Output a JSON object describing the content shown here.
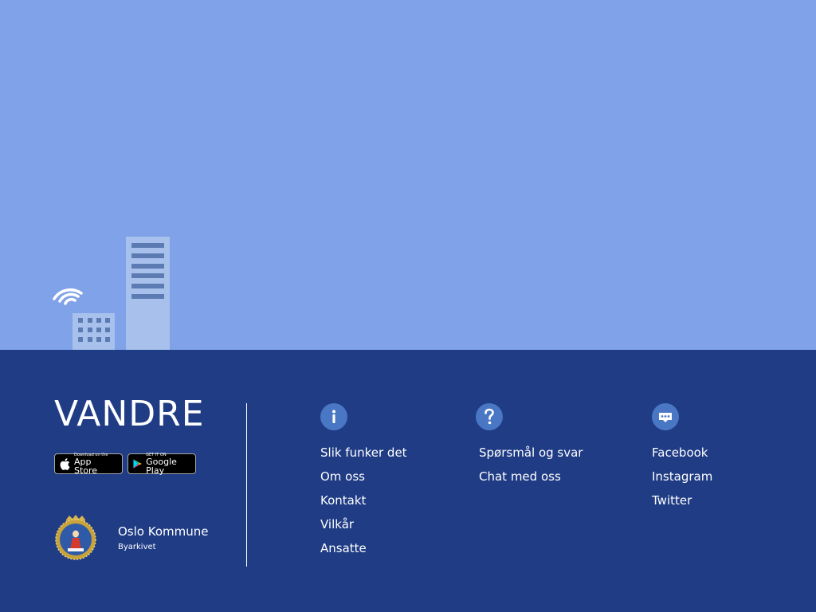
{
  "brand": {
    "name": "VANDRE"
  },
  "stores": {
    "apple": {
      "small": "Download on the",
      "big": "App Store",
      "icon": "apple-icon"
    },
    "google": {
      "small": "GET IT ON",
      "big": "Google Play",
      "icon": "google-play-icon"
    }
  },
  "city": {
    "name": "Oslo Kommune",
    "sub": "Byarkivet",
    "icon": "oslo-coat-of-arms-icon"
  },
  "columns": [
    {
      "icon": "info-icon",
      "links": [
        "Slik funker det",
        "Om oss",
        "Kontakt",
        "Vilkår",
        "Ansatte"
      ]
    },
    {
      "icon": "question-icon",
      "links": [
        "Spørsmål og svar",
        "Chat med oss"
      ]
    },
    {
      "icon": "chat-bubble-icon",
      "links": [
        "Facebook",
        "Instagram",
        "Twitter"
      ]
    }
  ],
  "colors": {
    "sky": "#80a2e8",
    "footer": "#1f3c85",
    "icon_circle": "#4a77c4",
    "building": "#a7c1ec",
    "window": "#5b7bb2"
  }
}
